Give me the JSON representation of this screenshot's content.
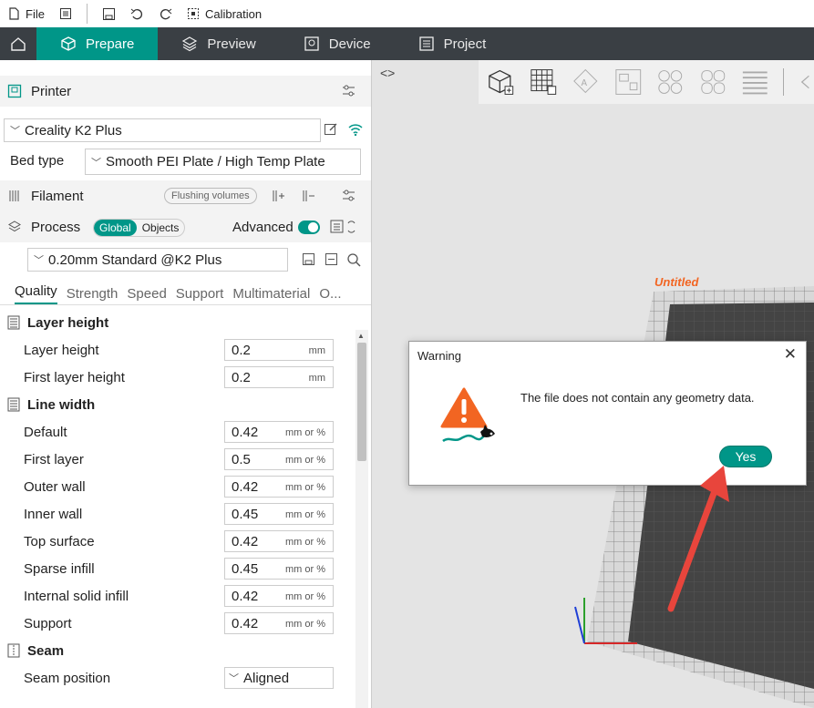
{
  "topbar": {
    "file": "File",
    "calibration": "Calibration"
  },
  "nav": {
    "tabs": [
      {
        "label": "Prepare"
      },
      {
        "label": "Preview"
      },
      {
        "label": "Device"
      },
      {
        "label": "Project"
      }
    ]
  },
  "printer": {
    "title": "Printer",
    "name": "Creality K2 Plus",
    "bed_label": "Bed type",
    "bed_value": "Smooth PEI Plate / High Temp Plate"
  },
  "filament": {
    "title": "Filament",
    "flushing": "Flushing volumes"
  },
  "process": {
    "title": "Process",
    "global": "Global",
    "objects": "Objects",
    "advanced": "Advanced",
    "preset": "0.20mm Standard @K2 Plus"
  },
  "tabs": [
    "Quality",
    "Strength",
    "Speed",
    "Support",
    "Multimaterial",
    "O..."
  ],
  "sections": {
    "layer_height": {
      "title": "Layer height",
      "rows": [
        {
          "label": "Layer height",
          "value": "0.2",
          "unit": "mm"
        },
        {
          "label": "First layer height",
          "value": "0.2",
          "unit": "mm"
        }
      ]
    },
    "line_width": {
      "title": "Line width",
      "rows": [
        {
          "label": "Default",
          "value": "0.42",
          "unit": "mm or %"
        },
        {
          "label": "First layer",
          "value": "0.5",
          "unit": "mm or %"
        },
        {
          "label": "Outer wall",
          "value": "0.42",
          "unit": "mm or %"
        },
        {
          "label": "Inner wall",
          "value": "0.45",
          "unit": "mm or %"
        },
        {
          "label": "Top surface",
          "value": "0.42",
          "unit": "mm or %"
        },
        {
          "label": "Sparse infill",
          "value": "0.45",
          "unit": "mm or %"
        },
        {
          "label": "Internal solid infill",
          "value": "0.42",
          "unit": "mm or %"
        },
        {
          "label": "Support",
          "value": "0.42",
          "unit": "mm or %"
        }
      ]
    },
    "seam": {
      "title": "Seam",
      "rows": [
        {
          "label": "Seam position",
          "value": "Aligned"
        }
      ]
    }
  },
  "plate": {
    "label": "Untitled"
  },
  "dialog": {
    "title": "Warning",
    "message": "The file does not contain any geometry data.",
    "yes": "Yes",
    "close": "✕"
  },
  "colors": {
    "accent": "#009688",
    "nav_bg": "#3a3f44",
    "warning": "#f26522",
    "arrow": "#e8453c"
  }
}
